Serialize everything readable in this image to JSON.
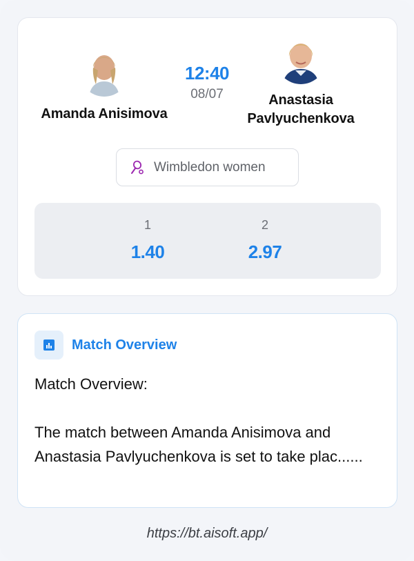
{
  "match": {
    "player1": {
      "name": "Amanda Anisimova",
      "avatar_icon": "player-photo"
    },
    "player2": {
      "name": "Anastasia Pavlyuchenkova",
      "avatar_icon": "player-photo"
    },
    "time": "12:40",
    "date": "08/07",
    "league": {
      "label": "Wimbledon women",
      "icon": "tennis-racket-icon"
    },
    "odds": [
      {
        "label": "1",
        "value": "1.40"
      },
      {
        "label": "2",
        "value": "2.97"
      }
    ]
  },
  "overview": {
    "icon": "chart-icon",
    "title": "Match Overview",
    "heading": "Match Overview:",
    "text": "The match between Amanda Anisimova and Anastasia Pavlyuchenkova is set to take plac......"
  },
  "footer": {
    "url": "https://bt.aisoft.app/"
  },
  "colors": {
    "accent": "#1e82e8",
    "background": "#f3f5f9",
    "panel": "#eceef2"
  }
}
